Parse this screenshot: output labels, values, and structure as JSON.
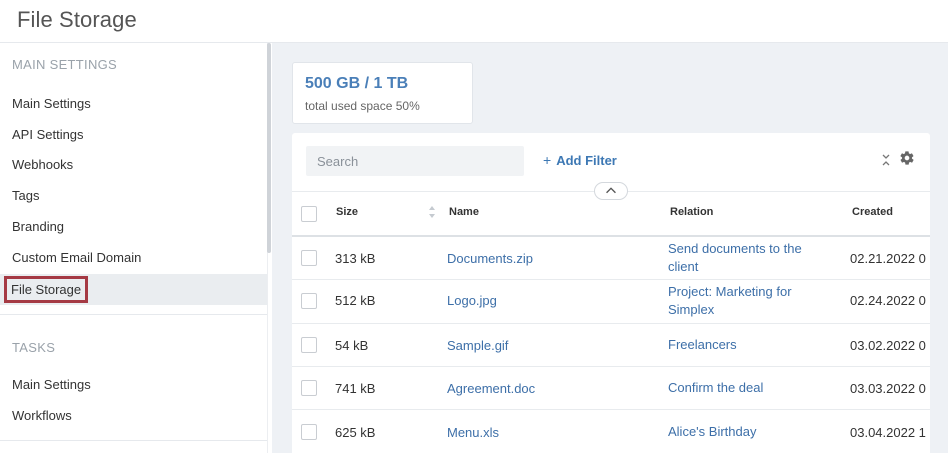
{
  "header": {
    "title": "File Storage"
  },
  "sidebar": {
    "sections": [
      {
        "title": "MAIN SETTINGS"
      },
      {
        "title": "TASKS"
      }
    ],
    "main_items": [
      {
        "label": "Main Settings"
      },
      {
        "label": "API Settings"
      },
      {
        "label": "Webhooks"
      },
      {
        "label": "Tags"
      },
      {
        "label": "Branding"
      },
      {
        "label": "Custom Email Domain"
      },
      {
        "label": "File Storage"
      }
    ],
    "task_items": [
      {
        "label": "Main Settings"
      },
      {
        "label": "Workflows"
      }
    ],
    "active_item": "File Storage"
  },
  "storage": {
    "value": "500 GB / 1 TB",
    "subtitle": "total used space 50%"
  },
  "toolbar": {
    "search_placeholder": "Search",
    "add_filter_label": "Add Filter",
    "add_filter_icon": "+"
  },
  "table": {
    "columns": [
      "Size",
      "Name",
      "Relation",
      "Created"
    ],
    "rows": [
      {
        "size": "313 kB",
        "name": "Documents.zip",
        "relation": "Send documents to the client",
        "created": "02.21.2022 0"
      },
      {
        "size": "512 kB",
        "name": "Logo.jpg",
        "relation": "Project: Marketing for Simplex",
        "created": "02.24.2022 0"
      },
      {
        "size": "54 kB",
        "name": "Sample.gif",
        "relation": "Freelancers",
        "created": "03.02.2022 0"
      },
      {
        "size": "741 kB",
        "name": "Agreement.doc",
        "relation": "Confirm the deal",
        "created": "03.03.2022 0"
      },
      {
        "size": "625 kB",
        "name": "Menu.xls",
        "relation": "Alice's Birthday",
        "created": "03.04.2022 1"
      }
    ]
  },
  "colors": {
    "accent": "#3d78b4",
    "active_outline": "#a53a44",
    "main_bg": "#eef1f5"
  }
}
